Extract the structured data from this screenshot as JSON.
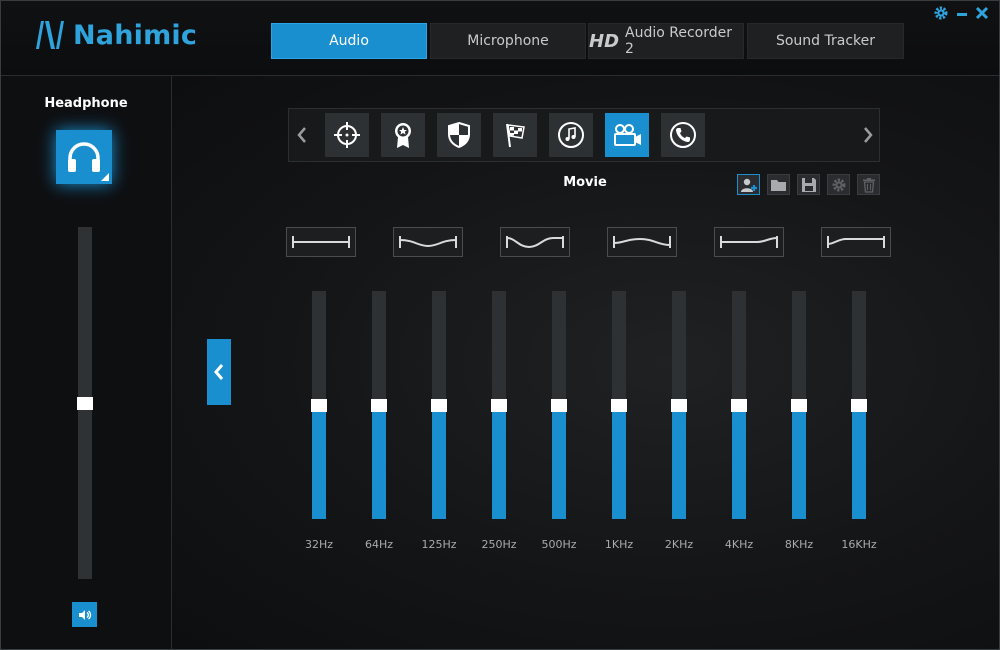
{
  "app": {
    "logo_text": "Nahimic"
  },
  "tabs": [
    {
      "label": "Audio",
      "active": true
    },
    {
      "label": "Microphone",
      "active": false
    },
    {
      "label": "Audio Recorder 2",
      "prefix": "HD",
      "active": false
    },
    {
      "label": "Sound Tracker",
      "active": false
    }
  ],
  "window_controls": {
    "settings": "settings-gear-icon",
    "minimize": "minimize-icon",
    "close": "close-icon"
  },
  "device": {
    "label": "Headphone",
    "icon": "headphone-icon",
    "volume": 0.5
  },
  "presets": {
    "items": [
      {
        "icon": "crosshair-icon",
        "active": false
      },
      {
        "icon": "award-badge-icon",
        "active": false
      },
      {
        "icon": "shield-icon",
        "active": false
      },
      {
        "icon": "racing-flag-icon",
        "active": false
      },
      {
        "icon": "music-note-icon",
        "active": false
      },
      {
        "icon": "video-camera-icon",
        "active": true
      },
      {
        "icon": "phone-icon",
        "active": false
      }
    ],
    "selected_name": "Movie",
    "actions": [
      "add-profile-icon",
      "open-folder-icon",
      "save-icon",
      "settings-icon",
      "trash-icon"
    ]
  },
  "eq": {
    "curve_presets": [
      "flat-curve-icon",
      "smile-curve-icon",
      "wave-curve-icon",
      "bass-cut-curve-icon",
      "treble-cut-curve-icon",
      "high-boost-curve-icon"
    ],
    "bands": [
      {
        "freq": "32Hz",
        "level": 0.5
      },
      {
        "freq": "64Hz",
        "level": 0.5
      },
      {
        "freq": "125Hz",
        "level": 0.5
      },
      {
        "freq": "250Hz",
        "level": 0.5
      },
      {
        "freq": "500Hz",
        "level": 0.5
      },
      {
        "freq": "1KHz",
        "level": 0.5
      },
      {
        "freq": "2KHz",
        "level": 0.5
      },
      {
        "freq": "4KHz",
        "level": 0.5
      },
      {
        "freq": "8KHz",
        "level": 0.5
      },
      {
        "freq": "16KHz",
        "level": 0.5
      }
    ]
  },
  "colors": {
    "accent": "#1a8fd0",
    "track": "#2e3134",
    "thumb": "#ffffff"
  }
}
